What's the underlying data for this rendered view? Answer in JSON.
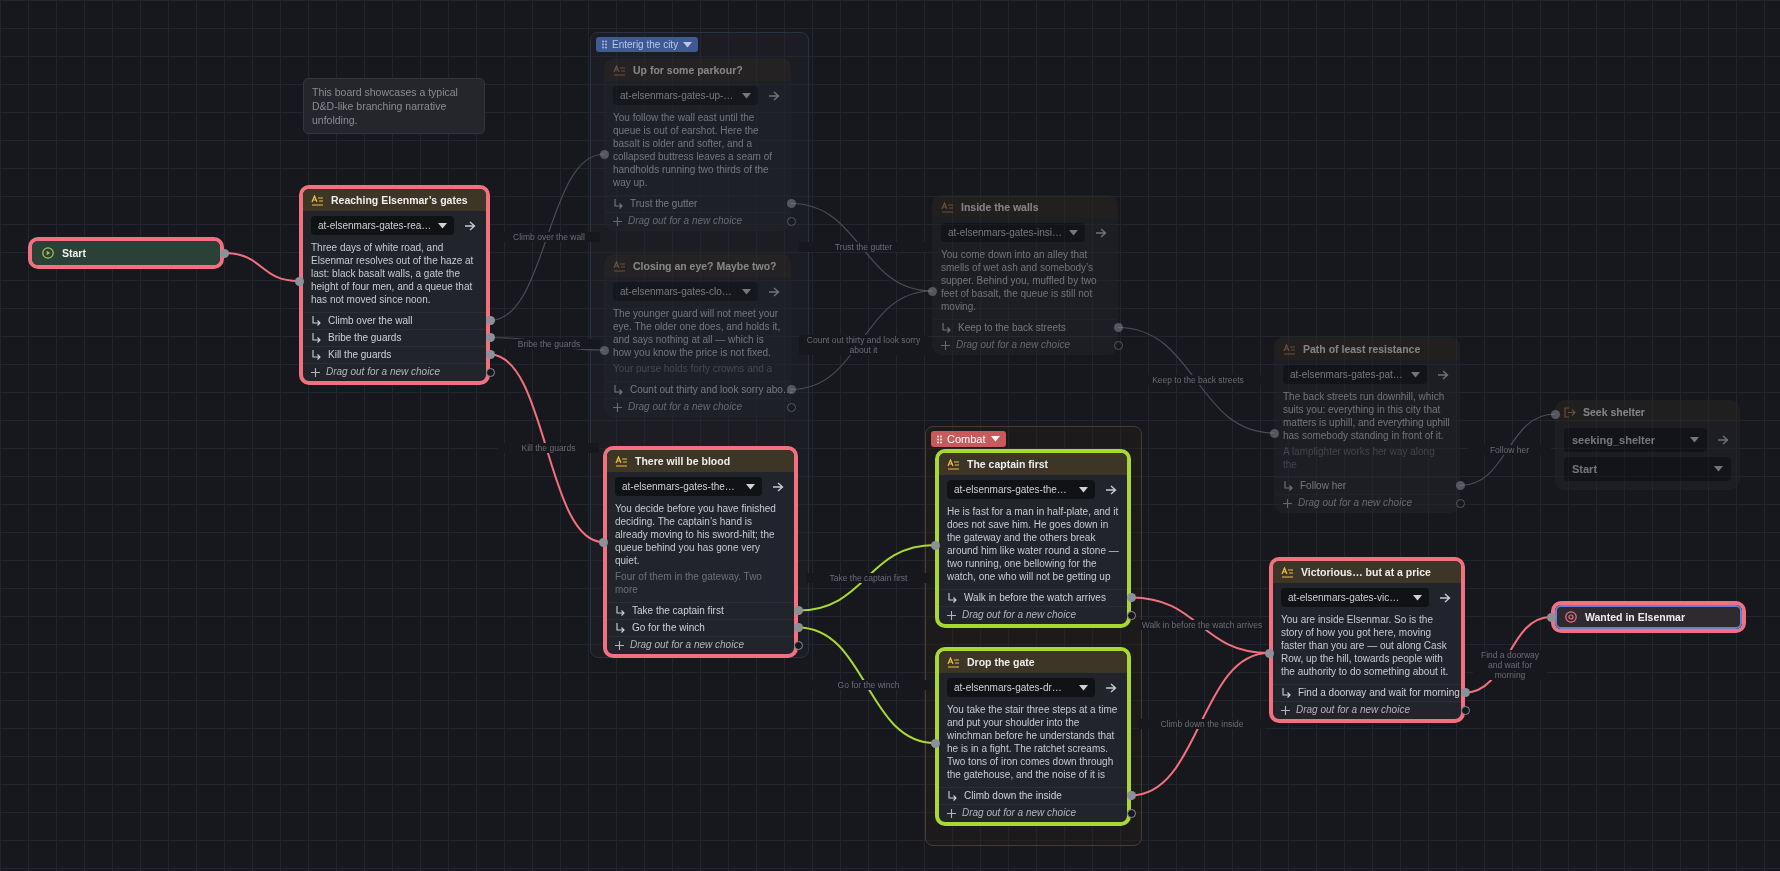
{
  "comment": {
    "text": "This board showcases a typical D&D-like branching narrative unfolding."
  },
  "groups": [
    {
      "label": "Enterig the city",
      "color": "#3d5a96"
    },
    {
      "label": "Combat",
      "color": "#c75b5b"
    }
  ],
  "nodes": [
    {
      "kind": "start",
      "title": "Start",
      "highlighted": true,
      "selected": false
    },
    {
      "kind": "passage",
      "title": "Reaching Elsenmar’s gates",
      "slug": "at-elsenmars-gates-rea…",
      "body": [
        "Three days of white road, and Elsenmar resolves out of the haze at last: black basalt walls, a gate the height of four men, and a queue that has not moved since noon."
      ],
      "choices": [
        "Climb over the wall",
        "Bribe the guards",
        "Kill the guards"
      ],
      "new_choice": "Drag out for a new choice",
      "highlighted": true,
      "selected": false
    },
    {
      "kind": "passage",
      "title": "Up for some parkour?",
      "slug": "at-elsenmars-gates-up-…",
      "body": [
        "You follow the wall east until the queue is out of earshot. Here the basalt is older and softer, and a collapsed buttress leaves a seam of handholds running two thirds of the way up."
      ],
      "choices": [
        "Trust the gutter"
      ],
      "new_choice": "Drag out for a new choice",
      "highlighted": false,
      "selected": false
    },
    {
      "kind": "passage",
      "title": "Closing an eye? Maybe two?",
      "slug": "at-elsenmars-gates-clo…",
      "body": [
        "The younger guard will not meet your eye. The older one does, and holds it, and says nothing at all — which is how you know the price is not fixed.",
        "Your purse holds forty crowns and a"
      ],
      "choices": [
        "Count out thirty and look sorry abo…"
      ],
      "new_choice": "Drag out for a new choice",
      "highlighted": false,
      "selected": false
    },
    {
      "kind": "passage",
      "title": "There will be blood",
      "slug": "at-elsenmars-gates-the…",
      "body": [
        "You decide before you have finished deciding. The captain’s hand is already moving to his sword-hilt; the queue behind you has gone very quiet.",
        "Four of them in the gateway. Two more"
      ],
      "choices": [
        "Take the captain first",
        "Go for the winch"
      ],
      "new_choice": "Drag out for a new choice",
      "highlighted": true,
      "selected": false
    },
    {
      "kind": "passage",
      "title": "Inside the walls",
      "slug": "at-elsenmars-gates-insi…",
      "body": [
        "You come down into an alley that smells of wet ash and somebody’s supper. Behind you, muffled by two feet of basalt, the queue is still not moving."
      ],
      "choices": [
        "Keep to the back streets"
      ],
      "new_choice": "Drag out for a new choice",
      "highlighted": false,
      "selected": false
    },
    {
      "kind": "passage",
      "title": "Path of least resistance",
      "slug": "at-elsenmars-gates-pat…",
      "body": [
        "The back streets run downhill, which suits you: everything in this city that matters is uphill, and everything uphill has somebody standing in front of it.",
        "A lamplighter works her way along the"
      ],
      "choices": [
        "Follow her"
      ],
      "new_choice": "Drag out for a new choice",
      "highlighted": false,
      "selected": false
    },
    {
      "kind": "jump",
      "title": "Seek shelter",
      "target": "seeking_shelter",
      "entry": "Start",
      "highlighted": false,
      "selected": false
    },
    {
      "kind": "passage",
      "title": "The captain first",
      "slug": "at-elsenmars-gates-the…",
      "body": [
        "He is fast for a man in half-plate, and it does not save him. He goes down in the gateway and the others break around him like water round a stone — two running, one bellowing for the watch, one who will not be getting up"
      ],
      "choices": [
        "Walk in before the watch arrives"
      ],
      "new_choice": "Drag out for a new choice",
      "highlighted": false,
      "selected": true
    },
    {
      "kind": "passage",
      "title": "Drop the gate",
      "slug": "at-elsenmars-gates-dr…",
      "body": [
        "You take the stair three steps at a time and put your shoulder into the winchman before he understands that he is in a fight. The ratchet screams. Two tons of iron comes down through the gatehouse, and the noise of it is"
      ],
      "choices": [
        "Climb down the inside"
      ],
      "new_choice": "Drag out for a new choice",
      "highlighted": false,
      "selected": true
    },
    {
      "kind": "passage",
      "title": "Victorious… but at a price",
      "slug": "at-elsenmars-gates-vic…",
      "body": [
        "You are inside Elsenmar. So is the story of how you got here, moving faster than you are — out along Cask Row, up the hill, towards people with the authority to do something about it."
      ],
      "choices": [
        "Find a doorway and wait for morning"
      ],
      "new_choice": "Drag out for a new choice",
      "highlighted": true,
      "selected": false
    },
    {
      "kind": "end",
      "title": "Wanted in Elsenmar",
      "highlighted": true,
      "selected": false
    }
  ],
  "edges": [
    {
      "highlighted": true,
      "selected": false
    },
    {
      "label": "Climb over the wall",
      "highlighted": false,
      "selected": false
    },
    {
      "label": "Bribe the guards",
      "highlighted": false,
      "selected": false
    },
    {
      "label": "Kill the guards",
      "highlighted": true,
      "selected": false
    },
    {
      "label": "Trust the gutter",
      "highlighted": false,
      "selected": false
    },
    {
      "label": "Count out thirty and look sorry about it",
      "highlighted": false,
      "selected": false
    },
    {
      "label": "Keep to the back streets",
      "highlighted": false,
      "selected": false
    },
    {
      "label": "Follow her",
      "highlighted": false,
      "selected": false
    },
    {
      "label": "Take the captain first",
      "highlighted": false,
      "selected": true
    },
    {
      "label": "Go for the winch",
      "highlighted": false,
      "selected": true
    },
    {
      "label": "Walk in before the watch arrives",
      "highlighted": true,
      "selected": false
    },
    {
      "label": "Climb down the inside",
      "highlighted": true,
      "selected": false
    },
    {
      "label": "Find a doorway and wait for morning",
      "highlighted": true,
      "selected": false
    }
  ]
}
